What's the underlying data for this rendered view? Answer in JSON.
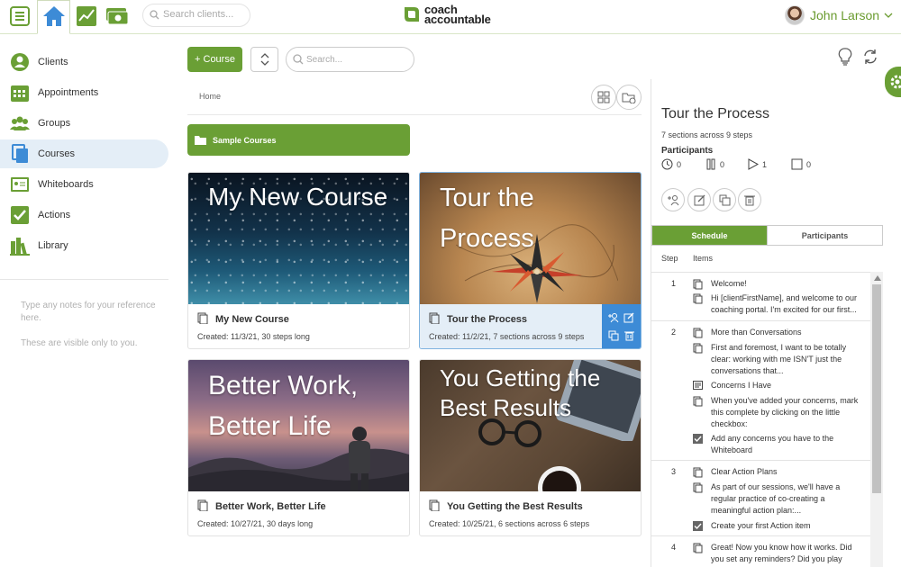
{
  "topbar": {
    "search_placeholder": "Search clients...",
    "logo_line1": "coach",
    "logo_line2": "accountable",
    "user_name": "John Larson"
  },
  "sidebar": {
    "items": [
      {
        "label": "Clients",
        "icon": "person-icon"
      },
      {
        "label": "Appointments",
        "icon": "calendar-icon"
      },
      {
        "label": "Groups",
        "icon": "group-icon"
      },
      {
        "label": "Courses",
        "icon": "courses-icon"
      },
      {
        "label": "Whiteboards",
        "icon": "whiteboard-icon"
      },
      {
        "label": "Actions",
        "icon": "checkbox-icon"
      },
      {
        "label": "Library",
        "icon": "library-icon"
      }
    ],
    "notes_line1": "Type any notes for your reference here.",
    "notes_line2": "These are visible only to you."
  },
  "toolbar": {
    "add_course_label": "+ Course",
    "search_placeholder": "Search..."
  },
  "breadcrumb": {
    "home": "Home"
  },
  "folder": {
    "label": "Sample Courses"
  },
  "courses": [
    {
      "image_title": "My New Course",
      "name": "My New Course",
      "meta": "Created: 11/3/21, 30 steps long"
    },
    {
      "image_title": "Tour the Process",
      "name": "Tour the Process",
      "meta": "Created: 11/2/21, 7 sections across 9 steps"
    },
    {
      "image_title": "Better Work, Better Life",
      "name": "Better Work, Better Life",
      "meta": "Created: 10/27/21, 30 days long"
    },
    {
      "image_title": "You Getting the Best Results",
      "name": "You Getting the Best Results",
      "meta": "Created: 10/25/21, 6 sections across 6 steps"
    }
  ],
  "detail": {
    "title": "Tour the Process",
    "subtitle": "7 sections across 9 steps",
    "participants_label": "Participants",
    "stats": [
      "0",
      "0",
      "1",
      "0"
    ],
    "tabs": [
      "Schedule",
      "Participants"
    ],
    "col_step": "Step",
    "col_items": "Items",
    "steps": [
      {
        "no": "1",
        "items": [
          "Welcome!",
          "Hi [clientFirstName], and welcome to our coaching portal.  I'm excited for our first..."
        ]
      },
      {
        "no": "2",
        "items": [
          "More than Conversations",
          "First and foremost, I want to be totally clear: working with me ISN'T just the conversations that...",
          "Concerns I Have",
          "When you've added your concerns, mark this complete by clicking on the little checkbox:",
          "Add any concerns you have to the Whiteboard"
        ]
      },
      {
        "no": "3",
        "items": [
          "Clear Action Plans",
          "As part of our sessions, we'll have a regular practice of co-creating a meaningful action plan:...",
          "Create your first Action item"
        ]
      },
      {
        "no": "4",
        "items": [
          "Great!  Now you know how it works.  Did you set any reminders?  Did you play"
        ]
      }
    ]
  }
}
